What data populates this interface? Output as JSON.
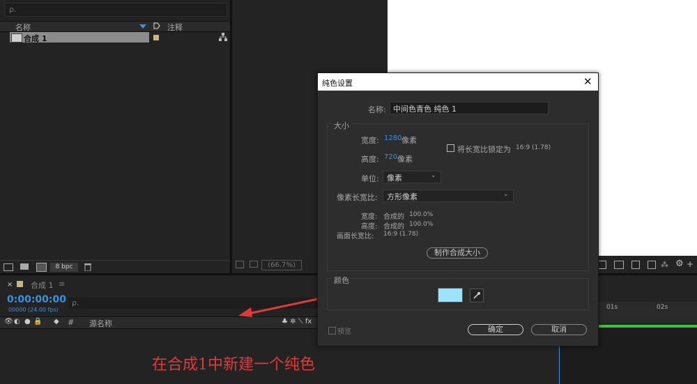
{
  "project_panel": {
    "search_placeholder": "ρ.",
    "col_name": "名称",
    "col_comment": "注释",
    "item_name": "合成 1",
    "bpc": "8 bpc"
  },
  "viewer": {
    "zoom": "(66.7%)"
  },
  "timeline": {
    "tab_label": "合成 1",
    "timecode": "0:00:00:00",
    "fps_text": "00000 (24.00 fps)",
    "search_placeholder": "ρ.",
    "col_hash": "#",
    "col_source": "源名称",
    "ruler_1": "01s",
    "ruler_2": "02s"
  },
  "dialog": {
    "title": "纯色设置",
    "name_label": "名称:",
    "name_value": "中间色青色 纯色 1",
    "size_section": "大小",
    "width_label": "宽度:",
    "width_value": "1280",
    "width_unit": "像素",
    "height_label": "高度:",
    "height_value": "720",
    "height_unit": "像素",
    "lock_label": "将长宽比锁定为",
    "lock_ratio": "16:9 (1.78)",
    "unit_label": "单位:",
    "unit_value": "像素",
    "pixel_aspect_label": "像素长宽比:",
    "pixel_aspect_value": "方形像素",
    "pct_width_label": "宽度:",
    "pct_width_value": "合成的",
    "pct_width_num": "100.0%",
    "pct_height_label": "高度:",
    "pct_height_value": "合成的",
    "pct_height_num": "100.0%",
    "frame_aspect_label": "画面长宽比:",
    "frame_aspect_value": "16:9 (1.78)",
    "make_comp_size": "制作合成大小",
    "color_section": "颜色",
    "swatch_color": "#9fe3f8",
    "preview_label": "预览",
    "ok_label": "确定",
    "cancel_label": "取消"
  },
  "annotation": {
    "caption": "在合成1中新建一个纯色",
    "color": "#e03a3a"
  }
}
